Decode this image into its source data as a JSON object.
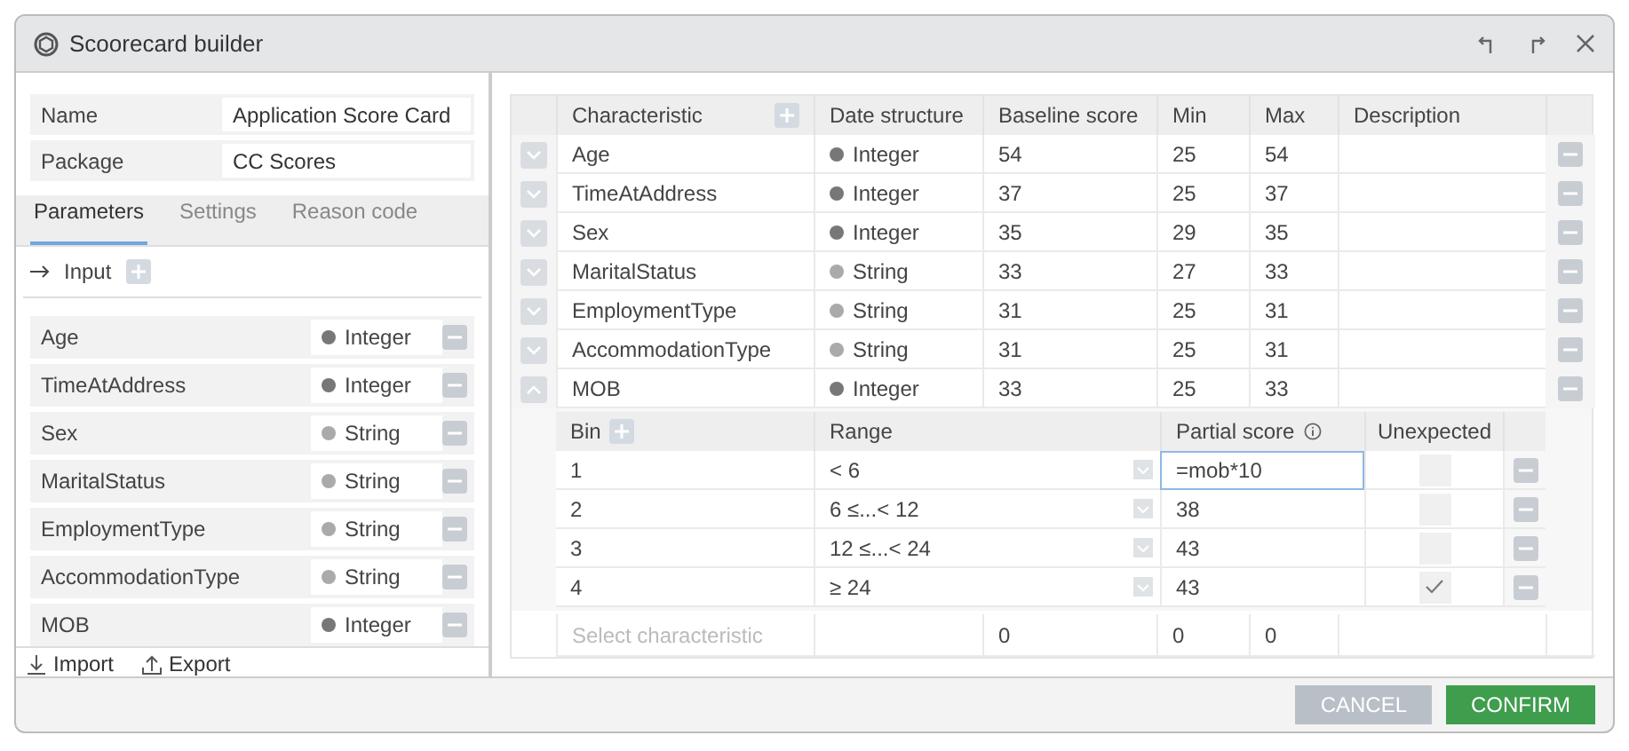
{
  "window": {
    "title": "Scoorecard builder"
  },
  "fields": [
    {
      "label": "Name",
      "value": "Application Score Card"
    },
    {
      "label": "Package",
      "value": "CC Scores"
    }
  ],
  "tabs": [
    {
      "label": "Parameters",
      "selected": true
    },
    {
      "label": "Settings",
      "selected": false
    },
    {
      "label": "Reason code",
      "selected": false
    }
  ],
  "input_section": {
    "label": "Input"
  },
  "parameters": [
    {
      "name": "Age",
      "type": "Integer",
      "kind": "integer"
    },
    {
      "name": "TimeAtAddress",
      "type": "Integer",
      "kind": "integer"
    },
    {
      "name": "Sex",
      "type": "String",
      "kind": "string"
    },
    {
      "name": "MaritalStatus",
      "type": "String",
      "kind": "string"
    },
    {
      "name": "EmploymentType",
      "type": "String",
      "kind": "string"
    },
    {
      "name": "AccommodationType",
      "type": "String",
      "kind": "string"
    },
    {
      "name": "MOB",
      "type": "Integer",
      "kind": "integer"
    }
  ],
  "actions": [
    "Import",
    "Export"
  ],
  "table": {
    "columns": [
      "Characteristic",
      "Date structure",
      "Baseline score",
      "Min",
      "Max",
      "Description"
    ],
    "rows": [
      {
        "characteristic": "Age",
        "type": "Integer",
        "kind": "integer",
        "baseline": "54",
        "min": "25",
        "max": "54",
        "expanded": false
      },
      {
        "characteristic": "TimeAtAddress",
        "type": "Integer",
        "kind": "integer",
        "baseline": "37",
        "min": "25",
        "max": "37",
        "expanded": false
      },
      {
        "characteristic": "Sex",
        "type": "Integer",
        "kind": "integer",
        "baseline": "35",
        "min": "29",
        "max": "35",
        "expanded": false
      },
      {
        "characteristic": "MaritalStatus",
        "type": "String",
        "kind": "string",
        "baseline": "33",
        "min": "27",
        "max": "33",
        "expanded": false
      },
      {
        "characteristic": "EmploymentType",
        "type": "String",
        "kind": "string",
        "baseline": "31",
        "min": "25",
        "max": "31",
        "expanded": false
      },
      {
        "characteristic": "AccommodationType",
        "type": "String",
        "kind": "string",
        "baseline": "31",
        "min": "25",
        "max": "31",
        "expanded": false
      },
      {
        "characteristic": "MOB",
        "type": "Integer",
        "kind": "integer",
        "baseline": "33",
        "min": "25",
        "max": "33",
        "expanded": true
      }
    ],
    "bins": {
      "columns": [
        "Bin",
        "Range",
        "Partial score",
        "Unexpected"
      ],
      "rows": [
        {
          "bin": "1",
          "range": "< 6",
          "partial_score": "=mob*10",
          "focused": true,
          "unexpected": false
        },
        {
          "bin": "2",
          "range": "6 ≤...< 12",
          "partial_score": "38",
          "focused": false,
          "unexpected": false
        },
        {
          "bin": "3",
          "range": "12 ≤...< 24",
          "partial_score": "43",
          "focused": false,
          "unexpected": false
        },
        {
          "bin": "4",
          "range": "≥ 24",
          "partial_score": "43",
          "focused": false,
          "unexpected": true
        }
      ]
    },
    "new_row": {
      "placeholder": "Select characteristic",
      "baseline": "0",
      "min": "0",
      "max": "0"
    }
  },
  "buttons": [
    {
      "label": "CANCEL",
      "kind": "secondary"
    },
    {
      "label": "CONFIRM",
      "kind": "primary"
    }
  ]
}
